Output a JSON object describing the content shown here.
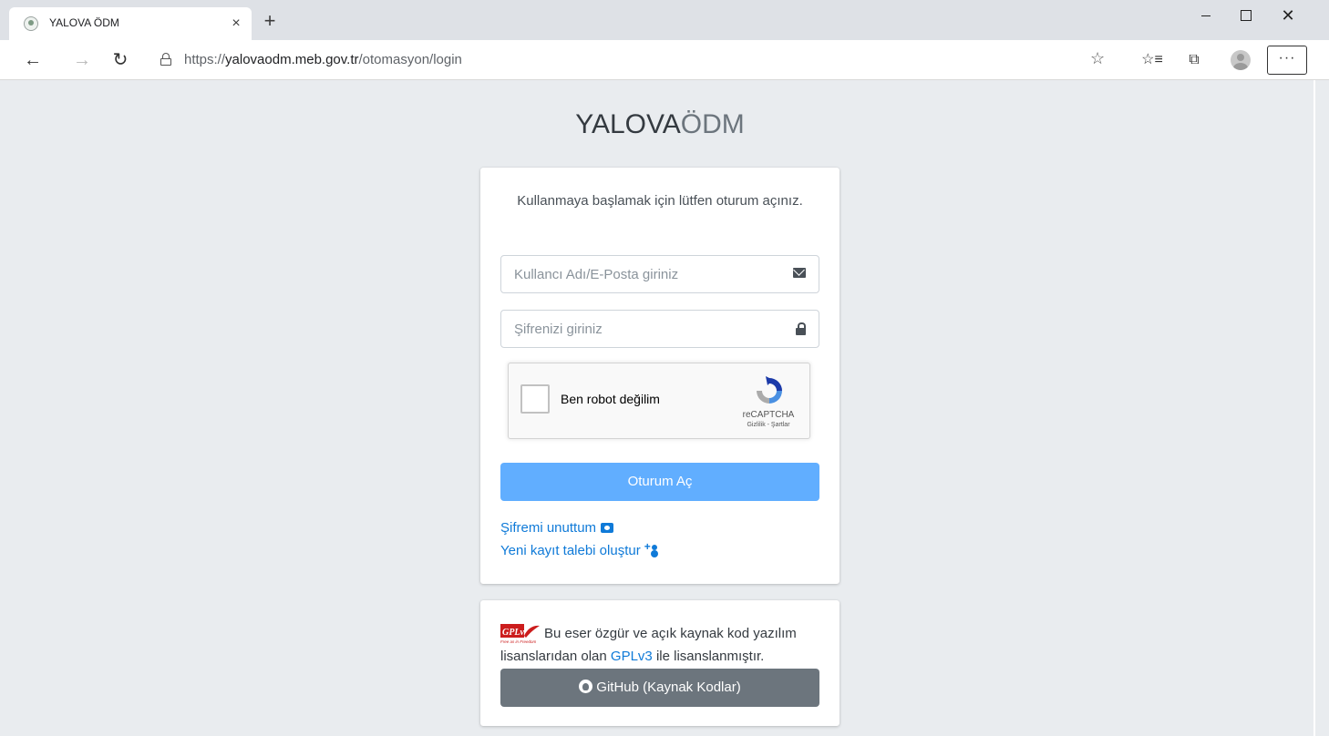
{
  "browser": {
    "tab_title": "YALOVA ÖDM",
    "tab_close": "×",
    "new_tab": "+",
    "url_prefix": "https://",
    "url_host": "yalovaodm.meb.gov.tr",
    "url_path": "/otomasyon/login",
    "more_label": "···",
    "icons": {
      "back": "←",
      "forward": "→",
      "refresh": "↻",
      "favorite": "☆",
      "favorites_list": "☆≡",
      "collections": "⧉",
      "close": "✕"
    }
  },
  "brand": {
    "strong": "YALOVA",
    "light": "ÖDM"
  },
  "login": {
    "intro": "Kullanmaya başlamak için lütfen oturum açınız.",
    "username_placeholder": "Kullancı Adı/E-Posta giriniz",
    "password_placeholder": "Şifrenizi giriniz",
    "recaptcha_label": "Ben robot değilim",
    "recaptcha_brand": "reCAPTCHA",
    "recaptcha_terms": "Gizlilik - Şartlar",
    "submit_label": "Oturum Aç",
    "forgot_label": "Şifremi unuttum",
    "register_label": "Yeni kayıt talebi oluştur"
  },
  "license": {
    "logo_text": "GPLv3",
    "logo_subtext": "Free as in Freedom",
    "text_before": "Bu eser özgür ve açık kaynak kod yazılım lisanslarıdan olan ",
    "link_label": "GPLv3",
    "text_after": " ile lisanslanmıştır.",
    "github_label": "GitHub (Kaynak Kodlar)"
  },
  "colors": {
    "page_bg": "#e9ecef",
    "primary_button": "#61aeff",
    "secondary_button": "#6c757d",
    "link": "#0f7ad8"
  }
}
